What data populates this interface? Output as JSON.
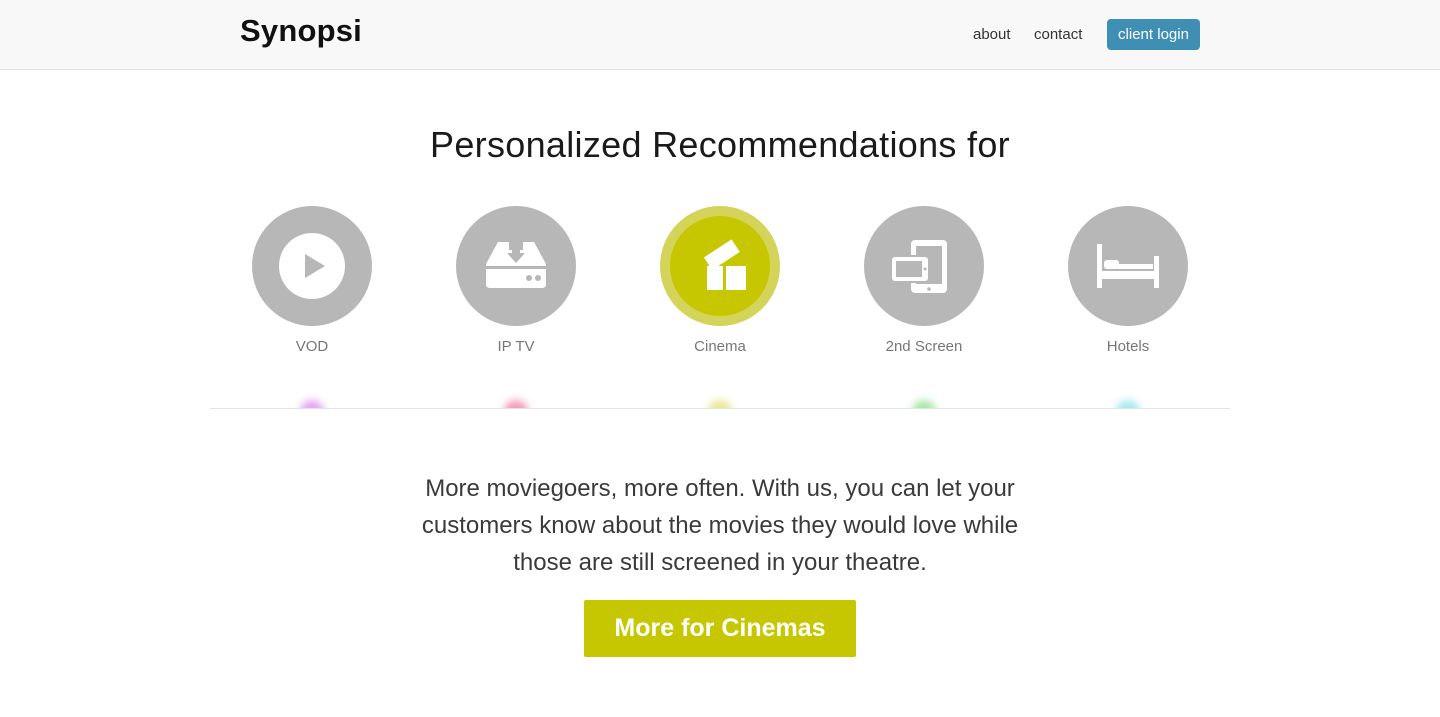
{
  "brand": "Synopsi",
  "nav": {
    "about": "about",
    "contact": "contact",
    "client_login": "client login"
  },
  "headline": "Personalized Recommendations for",
  "segments": [
    {
      "label": "VOD",
      "icon": "play-icon",
      "active": false,
      "glow_color": "#d36bf0"
    },
    {
      "label": "IP TV",
      "icon": "set-top-box-icon",
      "active": false,
      "glow_color": "#ee5a8e"
    },
    {
      "label": "Cinema",
      "icon": "ticket-icon",
      "active": true,
      "glow_color": "#d8d64a"
    },
    {
      "label": "2nd Screen",
      "icon": "devices-icon",
      "active": false,
      "glow_color": "#6ed86a"
    },
    {
      "label": "Hotels",
      "icon": "bed-icon",
      "active": false,
      "glow_color": "#6ad9e8"
    }
  ],
  "description": "More moviegoers, more often. With us, you can let your customers know about the movies they would love while those are still screened in your theatre.",
  "cta": "More for Cinemas",
  "colors": {
    "accent": "#c6c700",
    "accent_ring": "#d4d35a",
    "inactive_circle": "#b7b7b7",
    "login_button": "#3f8fb5"
  }
}
